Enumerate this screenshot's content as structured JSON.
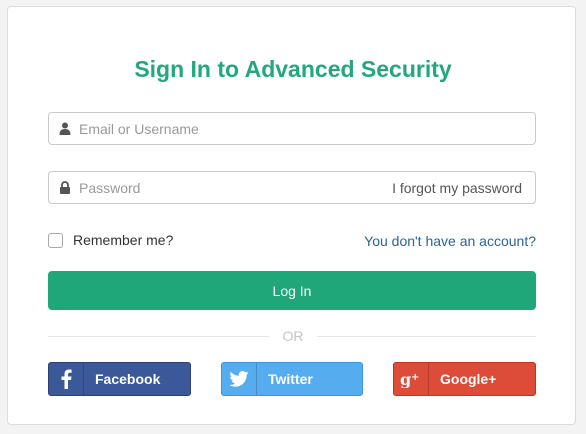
{
  "title": "Sign In to Advanced Security",
  "username": {
    "placeholder": "Email or Username",
    "value": "",
    "icon": "user-icon"
  },
  "password": {
    "placeholder": "Password",
    "value": "",
    "icon": "lock-icon",
    "forgot_label": "I forgot my password"
  },
  "remember": {
    "label": "Remember me?",
    "checked": false
  },
  "no_account_label": "You don't have an account?",
  "login_label": "Log In",
  "divider_label": "OR",
  "social": {
    "facebook": {
      "label": "Facebook",
      "icon": "facebook-icon",
      "color": "#3b5998"
    },
    "twitter": {
      "label": "Twitter",
      "icon": "twitter-icon",
      "color": "#55acee"
    },
    "google": {
      "label": "Google+",
      "icon": "google-plus-icon",
      "color": "#dd4b39"
    }
  },
  "colors": {
    "accent": "#20a779",
    "title": "#22a87a",
    "link": "#2a6496"
  }
}
